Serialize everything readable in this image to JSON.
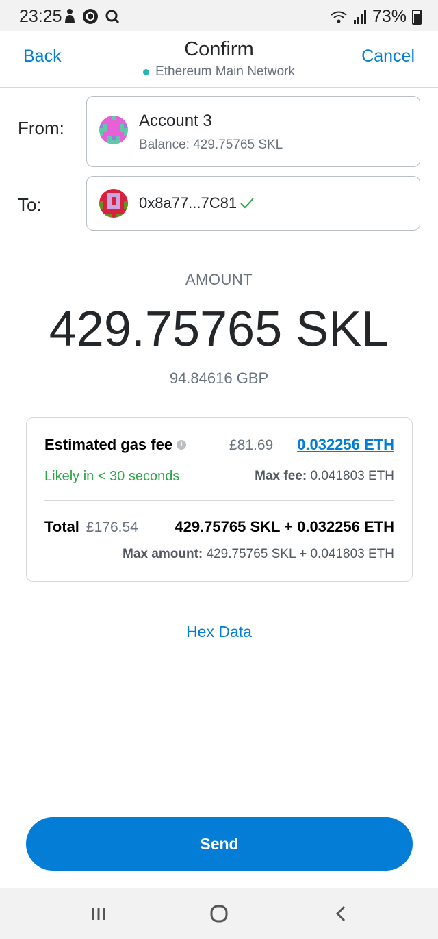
{
  "status_bar": {
    "time": "23:25",
    "battery": "73%"
  },
  "header": {
    "back_label": "Back",
    "title": "Confirm",
    "network": "Ethereum Main Network",
    "network_color": "#29b6af",
    "cancel_label": "Cancel"
  },
  "from": {
    "label": "From:",
    "account_name": "Account 3",
    "balance": "Balance: 429.75765 SKL",
    "avatar_icon": "identicon-pink-teal"
  },
  "to": {
    "label": "To:",
    "address": "0x8a77...7C81",
    "verified_icon": "check-icon",
    "avatar_icon": "identicon-red-green"
  },
  "amount": {
    "label": "AMOUNT",
    "value": "429.75765 SKL",
    "fiat": "94.84616 GBP"
  },
  "fee": {
    "title": "Estimated gas fee",
    "fiat": "£81.69",
    "eth": "0.032256 ETH",
    "likely": "Likely in < 30 seconds",
    "max_fee_label": "Max fee:",
    "max_fee_value": "0.041803 ETH",
    "total_label": "Total",
    "total_fiat": "£176.54",
    "total_crypto": "429.75765 SKL + 0.032256 ETH",
    "max_amount_label": "Max amount:",
    "max_amount_value": "429.75765 SKL + 0.041803 ETH"
  },
  "hex_data_label": "Hex Data",
  "send_label": "Send",
  "colors": {
    "accent": "#037dd6",
    "success": "#28a745"
  }
}
